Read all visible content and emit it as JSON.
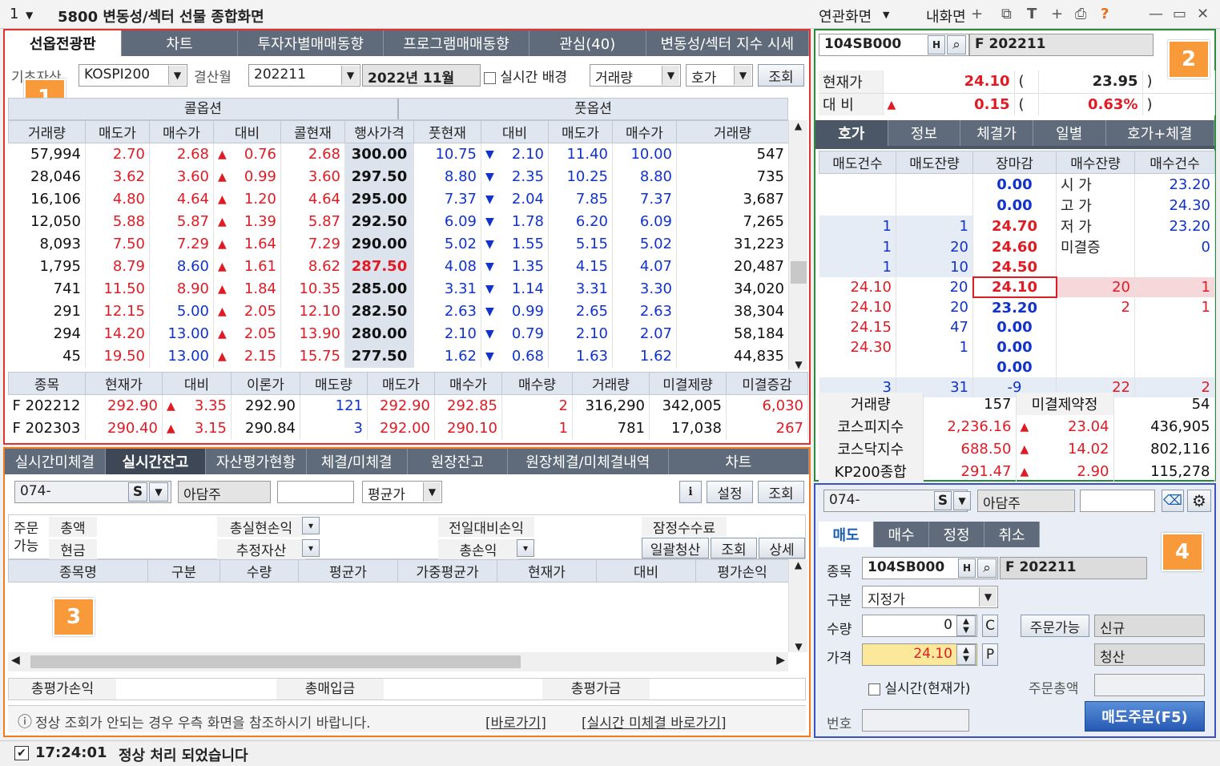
{
  "window": {
    "screen_no": "1",
    "title": "5800 변동성/섹터 선물 종합화면",
    "menu1": "연관화면",
    "menu2": "내화면"
  },
  "p1": {
    "badge": "1",
    "tabs": [
      "선옵전광판",
      "차트",
      "투자자별매매동향",
      "프로그램매매동향",
      "관심(40)",
      "변동성/섹터 지수 시세"
    ],
    "underlying_label": "기초자산",
    "underlying": "KOSPI200",
    "month_label": "결산월",
    "month": "202211",
    "month_text": "2022년 11월",
    "realtime_label": "실시간 배경",
    "sort1": "거래량",
    "sort2": "호가",
    "query": "조회",
    "call_label": "콜옵션",
    "put_label": "풋옵션",
    "cols": [
      "거래량",
      "매도가",
      "매수가",
      "대비",
      "콜현재",
      "행사가격",
      "풋현재",
      "대비",
      "매도가",
      "매수가",
      "거래량"
    ],
    "rows": [
      [
        "57,994",
        "2.70",
        "2.68",
        "0.76",
        "2.68",
        "300.00",
        "10.75",
        "2.10",
        "11.40",
        "10.00",
        "547"
      ],
      [
        "28,046",
        "3.62",
        "3.60",
        "0.99",
        "3.60",
        "297.50",
        "8.80",
        "2.35",
        "10.25",
        "8.80",
        "735"
      ],
      [
        "16,106",
        "4.80",
        "4.64",
        "1.20",
        "4.64",
        "295.00",
        "7.37",
        "2.04",
        "7.85",
        "7.37",
        "3,687"
      ],
      [
        "12,050",
        "5.88",
        "5.87",
        "1.39",
        "5.87",
        "292.50",
        "6.09",
        "1.78",
        "6.20",
        "6.09",
        "7,265"
      ],
      [
        "8,093",
        "7.50",
        "7.29",
        "1.64",
        "7.29",
        "290.00",
        "5.02",
        "1.55",
        "5.15",
        "5.02",
        "31,223"
      ],
      [
        "1,795",
        "8.79",
        "8.60",
        "1.61",
        "8.62",
        "287.50",
        "4.08",
        "1.35",
        "4.15",
        "4.07",
        "20,487"
      ],
      [
        "741",
        "11.50",
        "8.90",
        "1.84",
        "10.35",
        "285.00",
        "3.31",
        "1.14",
        "3.31",
        "3.30",
        "34,020"
      ],
      [
        "291",
        "12.15",
        "5.00",
        "2.05",
        "12.10",
        "282.50",
        "2.63",
        "0.99",
        "2.65",
        "2.63",
        "38,304"
      ],
      [
        "294",
        "14.20",
        "13.00",
        "2.05",
        "13.90",
        "280.00",
        "2.10",
        "0.79",
        "2.10",
        "2.07",
        "58,184"
      ],
      [
        "45",
        "19.50",
        "13.00",
        "2.15",
        "15.75",
        "277.50",
        "1.62",
        "0.68",
        "1.63",
        "1.62",
        "44,835"
      ]
    ],
    "fut_cols": [
      "종목",
      "현재가",
      "대비",
      "이론가",
      "매도량",
      "매도가",
      "매수가",
      "매수량",
      "거래량",
      "미결제량",
      "미결증감"
    ],
    "fut_rows": [
      [
        "F 202212",
        "292.90",
        "3.35",
        "292.90",
        "121",
        "292.90",
        "292.85",
        "2",
        "316,290",
        "342,005",
        "6,030"
      ],
      [
        "F 202303",
        "290.40",
        "3.15",
        "290.84",
        "3",
        "292.00",
        "290.10",
        "1",
        "781",
        "17,038",
        "267"
      ]
    ]
  },
  "p2": {
    "badge": "2",
    "code": "104SB000",
    "name": "F 202211",
    "price_label": "현재가",
    "price": "24.10",
    "base": "23.95",
    "chg_label": "대 비",
    "chg": "0.15",
    "chg_pct": "0.63%",
    "tabs": [
      "호가",
      "정보",
      "체결가",
      "일별",
      "호가+체결"
    ],
    "cols": [
      "매도건수",
      "매도잔량",
      "장마감",
      "매수잔량",
      "매수건수"
    ],
    "ob": [
      [
        "",
        "",
        "0.00",
        "시  가",
        "23.20"
      ],
      [
        "",
        "",
        "0.00",
        "고  가",
        "24.30"
      ],
      [
        "1",
        "1",
        "24.70",
        "저  가",
        "23.20"
      ],
      [
        "1",
        "20",
        "24.60",
        "미결증",
        "0"
      ],
      [
        "1",
        "10",
        "24.50",
        "",
        ""
      ]
    ],
    "ob2": [
      [
        "24.10",
        "20",
        "24.10",
        "20",
        "1"
      ],
      [
        "24.10",
        "20",
        "23.20",
        "2",
        "1"
      ],
      [
        "24.15",
        "47",
        "0.00",
        "",
        ""
      ],
      [
        "24.30",
        "1",
        "0.00",
        "",
        ""
      ],
      [
        "",
        "",
        "0.00",
        "",
        ""
      ]
    ],
    "totals": [
      "3",
      "31",
      "-9",
      "22",
      "2"
    ],
    "vol_label": "거래량",
    "vol": "157",
    "oi_label": "미결제약정",
    "oi": "54",
    "idx": [
      [
        "코스피지수",
        "2,236.16",
        "23.04",
        "436,905"
      ],
      [
        "코스닥지수",
        "688.50",
        "14.02",
        "802,116"
      ],
      [
        "KP200종합",
        "291.47",
        "2.90",
        "115,278"
      ]
    ]
  },
  "p3": {
    "badge": "3",
    "tabs": [
      "실시간미체결",
      "실시간잔고",
      "자산평가현황",
      "체결/미체결",
      "원장잔고",
      "원장체결/미체결내역",
      "차트"
    ],
    "account": "074-",
    "acct_type": "S",
    "owner": "아담주",
    "avg": "평균가",
    "settings": "설정",
    "query": "조회",
    "order_label1": "주문",
    "order_label2": "가능",
    "total": "총액",
    "cash": "현금",
    "realized": "총실현손익",
    "est_asset": "추정자산",
    "prev_pl": "전일대비손익",
    "total_pl": "총손익",
    "fee": "잠정수수료",
    "btn_all": "일괄청산",
    "btn_q": "조회",
    "btn_d": "상세",
    "cols": [
      "종목명",
      "구분",
      "수량",
      "평균가",
      "가중평균가",
      "현재가",
      "대비",
      "평가손익"
    ],
    "sum1": "총평가손익",
    "sum2": "총매입금",
    "sum3": "총평가금",
    "notice": "정상 조회가 안되는 경우 우측 화면을 참조하시기 바랍니다.",
    "link1": "[바로가기]",
    "link2": "[실시간 미체결 바로가기]"
  },
  "p4": {
    "badge": "4",
    "account": "074-",
    "acct_type": "S",
    "owner": "아담주",
    "tabs": [
      "매도",
      "매수",
      "정정",
      "취소"
    ],
    "item_label": "종목",
    "code": "104SB000",
    "name": "F 202211",
    "type_label": "구분",
    "type": "지정가",
    "qty_label": "수량",
    "qty": "0",
    "c": "C",
    "avail": "주문가능",
    "new": "신규",
    "price_label": "가격",
    "price": "24.10",
    "p": "P",
    "close": "청산",
    "realtime": "실시간(현재가)",
    "total_label": "주문총액",
    "no_label": "번호",
    "submit": "매도주문(F5)"
  },
  "status": {
    "time": "17:24:01",
    "msg": "정상 처리 되었습니다"
  },
  "colors": {
    "red_frame": "#e2322d",
    "green_frame": "#2b8a3e",
    "orange_frame": "#ee7d22",
    "blue_frame": "#3b52c4",
    "badge": "#f89a3a"
  }
}
